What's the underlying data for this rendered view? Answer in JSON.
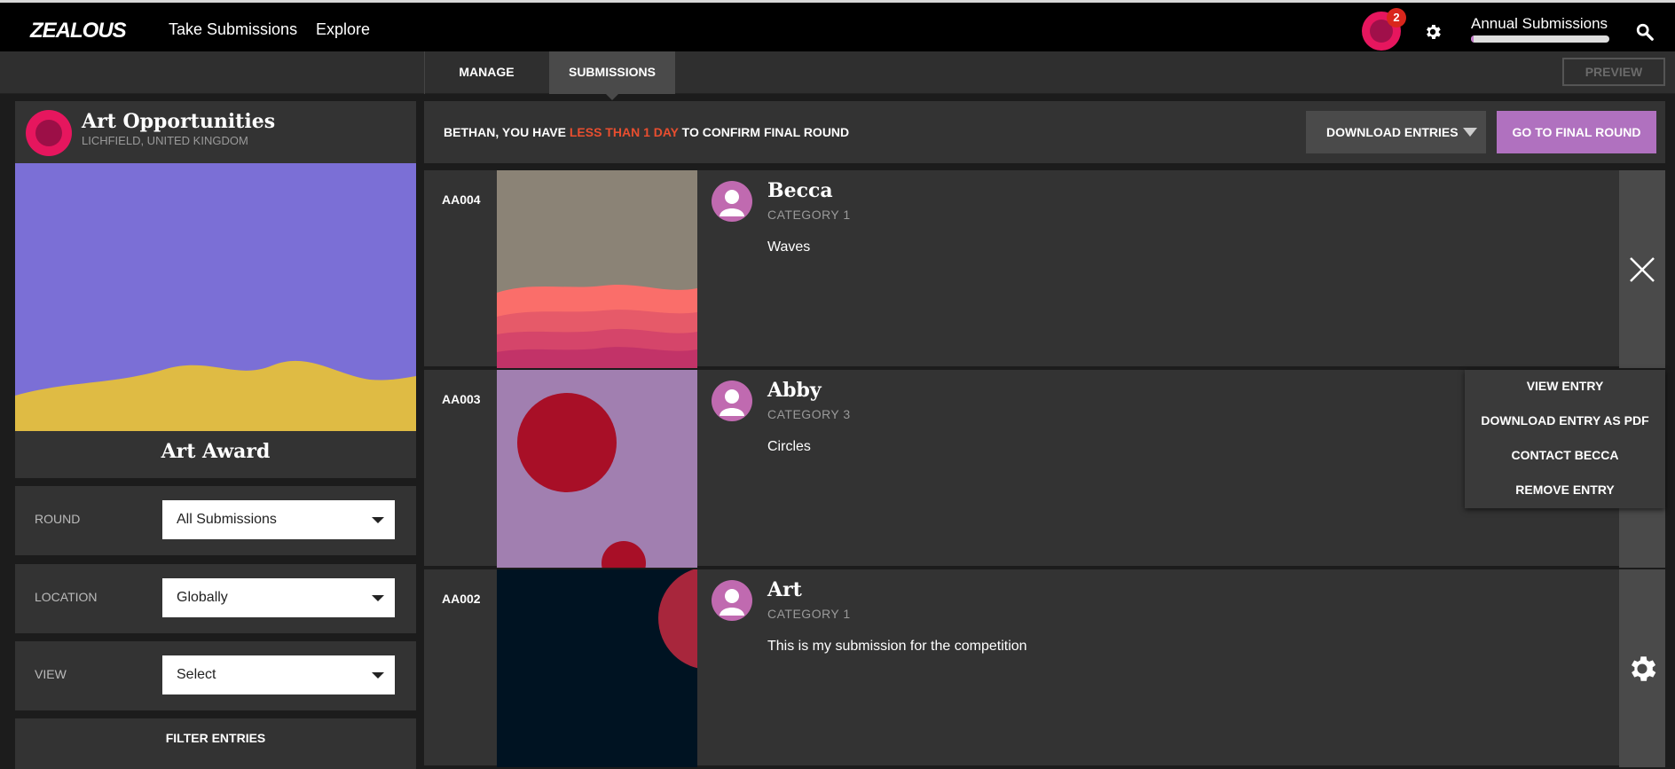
{
  "topbar": {
    "logo": "ZEALOUS",
    "nav": [
      "Take Submissions",
      "Explore"
    ],
    "notification_count": "2",
    "annual_label": "Annual Submissions",
    "annual_progress": 0.02
  },
  "subnav": {
    "tabs": [
      "MANAGE",
      "SUBMISSIONS"
    ],
    "preview_label": "PREVIEW"
  },
  "sidebar": {
    "org_name": "Art Opportunities",
    "org_location": "LICHFIELD, UNITED KINGDOM",
    "award_title": "Art Award",
    "filters": [
      {
        "label": "ROUND",
        "value": "All Submissions"
      },
      {
        "label": "LOCATION",
        "value": "Globally"
      },
      {
        "label": "VIEW",
        "value": "Select"
      }
    ],
    "filter_entries_label": "FILTER ENTRIES"
  },
  "notice": {
    "prefix": "BETHAN, YOU HAVE ",
    "highlight": "LESS THAN 1 DAY",
    "suffix": " TO CONFIRM FINAL ROUND",
    "download_label": "DOWNLOAD ENTRIES",
    "final_label": "GO TO FINAL ROUND"
  },
  "entries": [
    {
      "id": "AA004",
      "name": "Becca",
      "category": "CATEGORY 1",
      "description": "Waves"
    },
    {
      "id": "AA003",
      "name": "Abby",
      "category": "CATEGORY 3",
      "description": "Circles"
    },
    {
      "id": "AA002",
      "name": "Art",
      "category": "CATEGORY 1",
      "description": "This is my submission for the competition"
    }
  ],
  "menu": {
    "items": [
      "VIEW ENTRY",
      "DOWNLOAD ENTRY AS PDF",
      "CONTACT BECCA",
      "REMOVE ENTRY"
    ]
  },
  "colors": {
    "accent_pink": "#e6165e",
    "accent_purple": "#b071bf",
    "warning_red": "#e84e2f"
  }
}
